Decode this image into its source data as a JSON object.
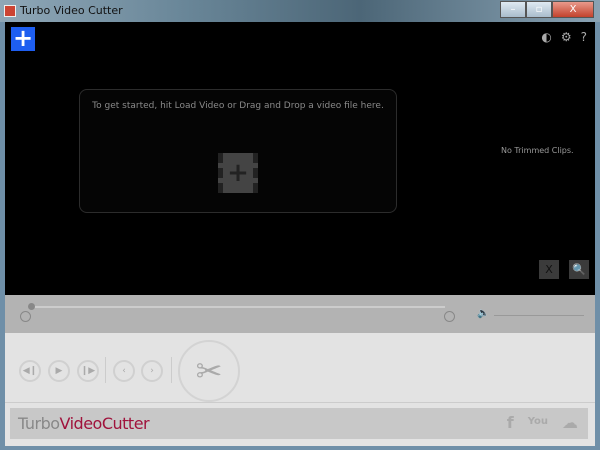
{
  "window": {
    "title": "Turbo Video Cutter",
    "minimize": "–",
    "maximize": "▫",
    "close": "X"
  },
  "toolbar": {
    "add_label": "+",
    "theme": "◐",
    "settings": "⚙",
    "help": "?"
  },
  "dropzone": {
    "text": "To get started, hit Load Video or Drag and Drop a video file here.",
    "icon": "+"
  },
  "clips": {
    "empty_text": "No Trimmed Clips.",
    "clear_icon": "X",
    "preview_icon": "🔍"
  },
  "timeline": {
    "position": 0,
    "volume_icon": "🔈",
    "volume": 1.0
  },
  "controls": {
    "prev_frame": "◀❙",
    "play": "▶",
    "next_frame": "❙▶",
    "mark_in": "‹",
    "mark_out": "›",
    "cut": "✂"
  },
  "footer": {
    "logo_turbo": "Turbo",
    "logo_video_cutter": "VideoCutter",
    "facebook": "f",
    "youtube": "You",
    "cloud": "☁"
  }
}
